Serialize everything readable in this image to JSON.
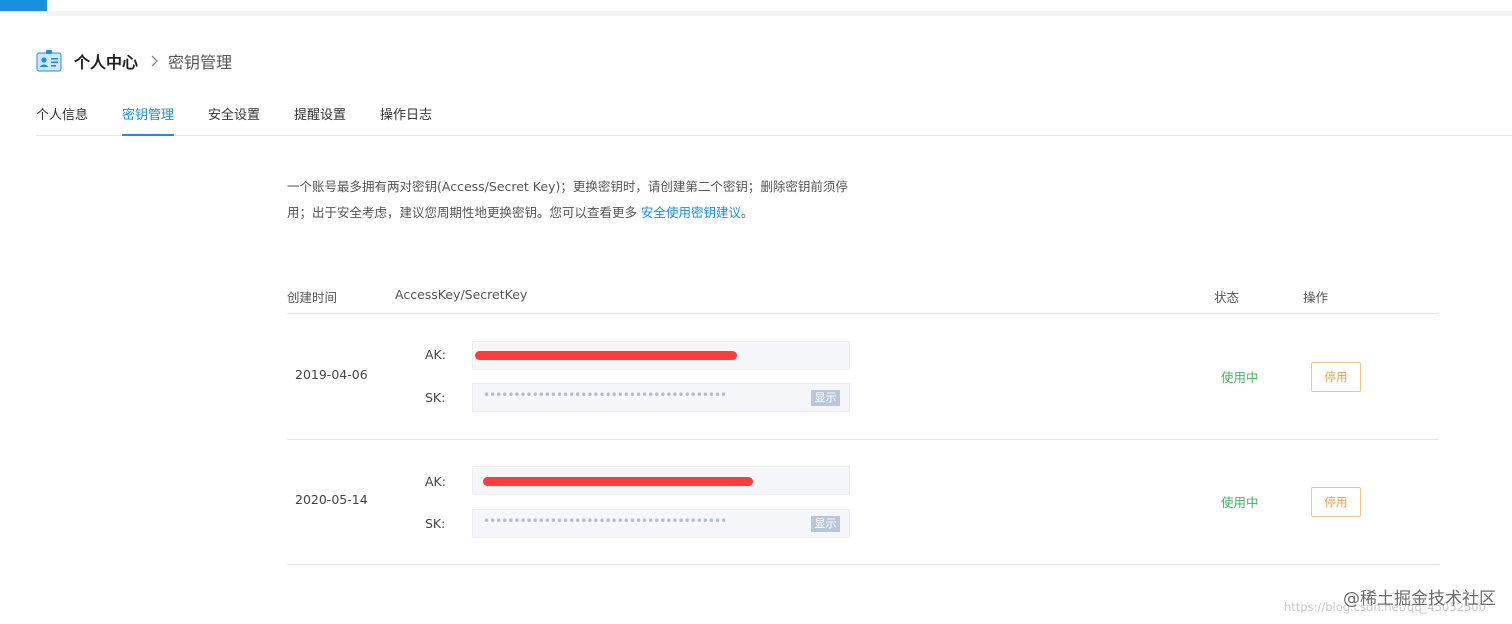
{
  "header": {
    "title": "个人中心",
    "subtitle": "密钥管理"
  },
  "tabs": [
    {
      "label": "个人信息",
      "active": false
    },
    {
      "label": "密钥管理",
      "active": true
    },
    {
      "label": "安全设置",
      "active": false
    },
    {
      "label": "提醒设置",
      "active": false
    },
    {
      "label": "操作日志",
      "active": false
    }
  ],
  "description": {
    "text_part1": "一个账号最多拥有两对密钥(Access/Secret Key)；更换密钥时，请创建第二个密钥；删除密钥前须停",
    "text_part2": "用；出于安全考虑，建议您周期性地更换密钥。您可以查看更多 ",
    "link": "安全使用密钥建议",
    "text_end": "。"
  },
  "table": {
    "columns": {
      "created": "创建时间",
      "keys": "AccessKey/SecretKey",
      "status": "状态",
      "action": "操作"
    },
    "ak_label": "AK:",
    "sk_label": "SK:",
    "show_label": "显示",
    "sk_mask": "••••••••••••••••••••••••••••••••••••••••",
    "rows": [
      {
        "created": "2019-04-06",
        "status": "使用中",
        "action": "停用"
      },
      {
        "created": "2020-05-14",
        "status": "使用中",
        "action": "停用"
      }
    ]
  },
  "colors": {
    "accent": "#1a8fe0",
    "status_active": "#3fb560",
    "disable_button": "#f0a04b",
    "redaction": "#ff3b3b"
  },
  "watermark": {
    "text": "@稀土掘金技术社区",
    "url": "https://blog.csdn.net/qq_45052500"
  }
}
